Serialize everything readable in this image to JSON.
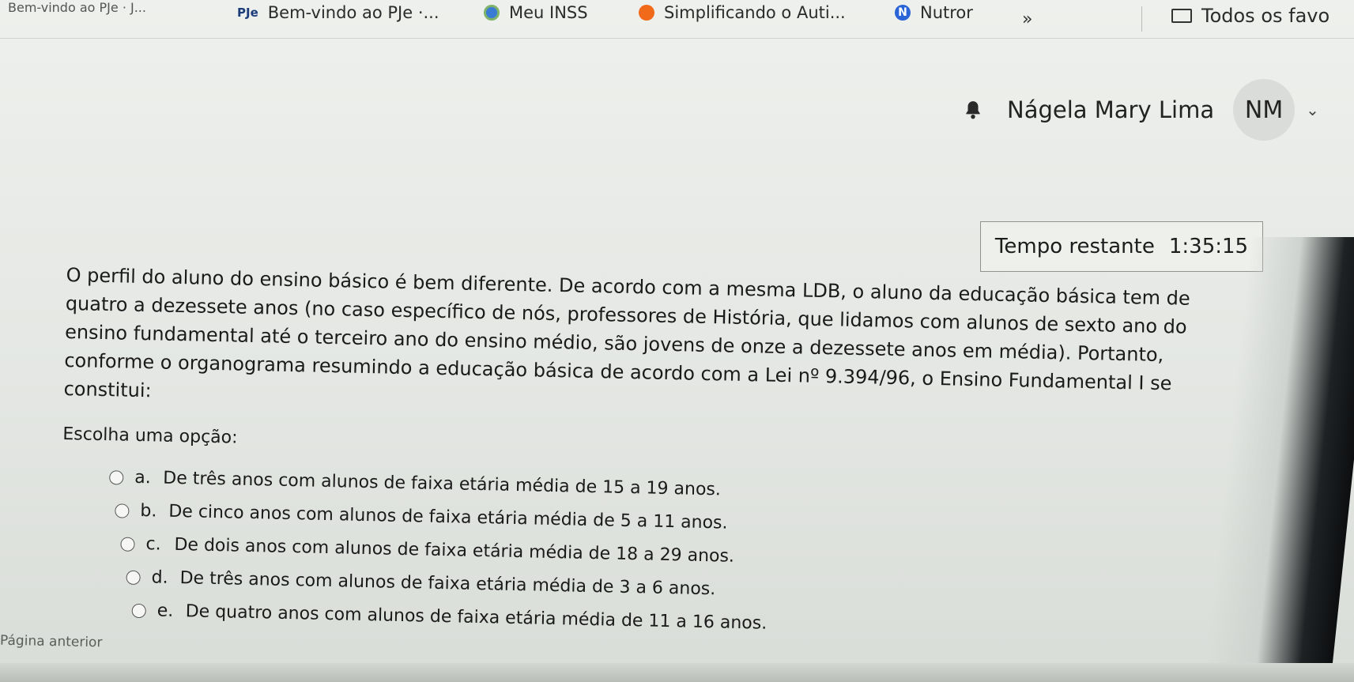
{
  "bookmarks": {
    "items": [
      {
        "label": "Bem-vindo ao PJe · J...",
        "icon": "pje-icon"
      },
      {
        "label": "Bem-vindo ao PJe ·...",
        "icon": "pje-icon"
      },
      {
        "label": "Meu INSS",
        "icon": "inss-icon"
      },
      {
        "label": "Simplificando o Auti...",
        "icon": "simplificando-icon"
      },
      {
        "label": "Nutror",
        "icon": "nutror-icon"
      }
    ],
    "more": "»",
    "all_favorites": "Todos os favo"
  },
  "user": {
    "name": "Nágela Mary Lima",
    "initials": "NM"
  },
  "timer": {
    "label": "Tempo restante",
    "value": "1:35:15"
  },
  "question": {
    "lines": [
      "O perfil do aluno do ensino básico é bem diferente. De acordo com a mesma LDB, o aluno da educação básica tem de",
      "quatro a dezessete anos (no caso específico de nós, professores de História, que lidamos com alunos de sexto ano do",
      "ensino fundamental até o terceiro ano do ensino médio, são jovens de onze a dezessete anos em média). Portanto,",
      "conforme o organograma resumindo a educação básica de acordo com a Lei nº 9.394/96, o Ensino Fundamental I se",
      "constitui:"
    ],
    "choose_label": "Escolha uma opção:",
    "options": [
      {
        "letter": "a.",
        "text": "De três anos com alunos de faixa etária média de 15 a 19 anos."
      },
      {
        "letter": "b.",
        "text": "De cinco anos com alunos de faixa etária média de 5 a 11 anos."
      },
      {
        "letter": "c.",
        "text": "De dois anos com alunos de faixa etária média de 18 a 29 anos."
      },
      {
        "letter": "d.",
        "text": "De três anos com alunos de faixa etária média de 3 a 6 anos."
      },
      {
        "letter": "e.",
        "text": "De quatro anos com alunos de faixa etária média de 11 a 16 anos."
      }
    ]
  },
  "navigation": {
    "previous_page": "Página anterior"
  }
}
